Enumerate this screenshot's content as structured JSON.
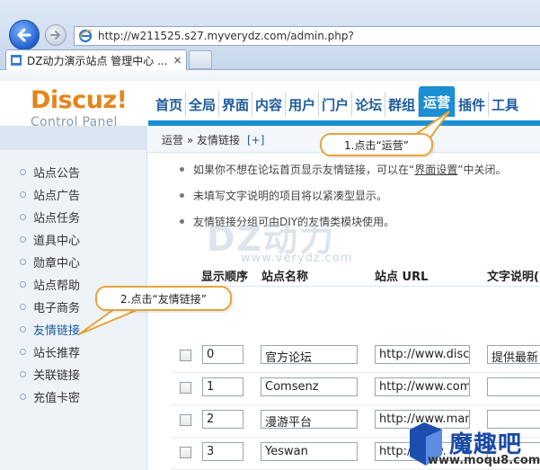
{
  "browser": {
    "address": "http://w211525.s27.myverydz.com/admin.php?",
    "tab_title": "DZ动力演示站点 管理中心 ...",
    "tab_close": "×"
  },
  "logo": {
    "main": "Discuz!",
    "sub": "Control Panel"
  },
  "topnav": [
    "首页",
    "全局",
    "界面",
    "内容",
    "用户",
    "门户",
    "论坛",
    "群组",
    "运营",
    "插件",
    "工具"
  ],
  "topnav_active": "运营",
  "sidebar": {
    "items": [
      "站点公告",
      "站点广告",
      "站点任务",
      "道具中心",
      "勋章中心",
      "站点帮助",
      "电子商务",
      "友情链接",
      "站长推荐",
      "关联链接",
      "充值卡密"
    ],
    "active": "友情链接"
  },
  "breadcrumb": {
    "path": "运营 » 友情链接",
    "plus": "[+]"
  },
  "tips": [
    {
      "before": "如果你不想在论坛首页显示友情链接，可以在“",
      "link": "界面设置",
      "after": "”中关闭。"
    },
    {
      "text": "未填写文字说明的项目将以紧凑型显示。"
    },
    {
      "text": "友情链接分组可由DIY的友情类模块使用。"
    }
  ],
  "columns": [
    "显示顺序",
    "站点名称",
    "站点 URL",
    "文字说明("
  ],
  "rows": [
    {
      "order": "0",
      "name": "官方论坛",
      "url": "http://www.disc",
      "desc": "提供最新"
    },
    {
      "order": "1",
      "name": "Comsenz",
      "url": "http://www.com",
      "desc": ""
    },
    {
      "order": "2",
      "name": "漫游平台",
      "url": "http://www.man",
      "desc": ""
    },
    {
      "order": "3",
      "name": "Yeswan",
      "url": "http://www.",
      "desc": ""
    }
  ],
  "callouts": {
    "c1": "1.点击“运营”",
    "c2": "2.点击“友情链接”"
  },
  "watermark": {
    "main": "DZ动力",
    "url": "www.verydz.com"
  },
  "corner": {
    "text": "魔趣吧",
    "url": "www.moqu8.com"
  },
  "colors": {
    "accent": "#1b8fd3",
    "logo": "#e2861d",
    "callout_border": "#e3a43a"
  }
}
